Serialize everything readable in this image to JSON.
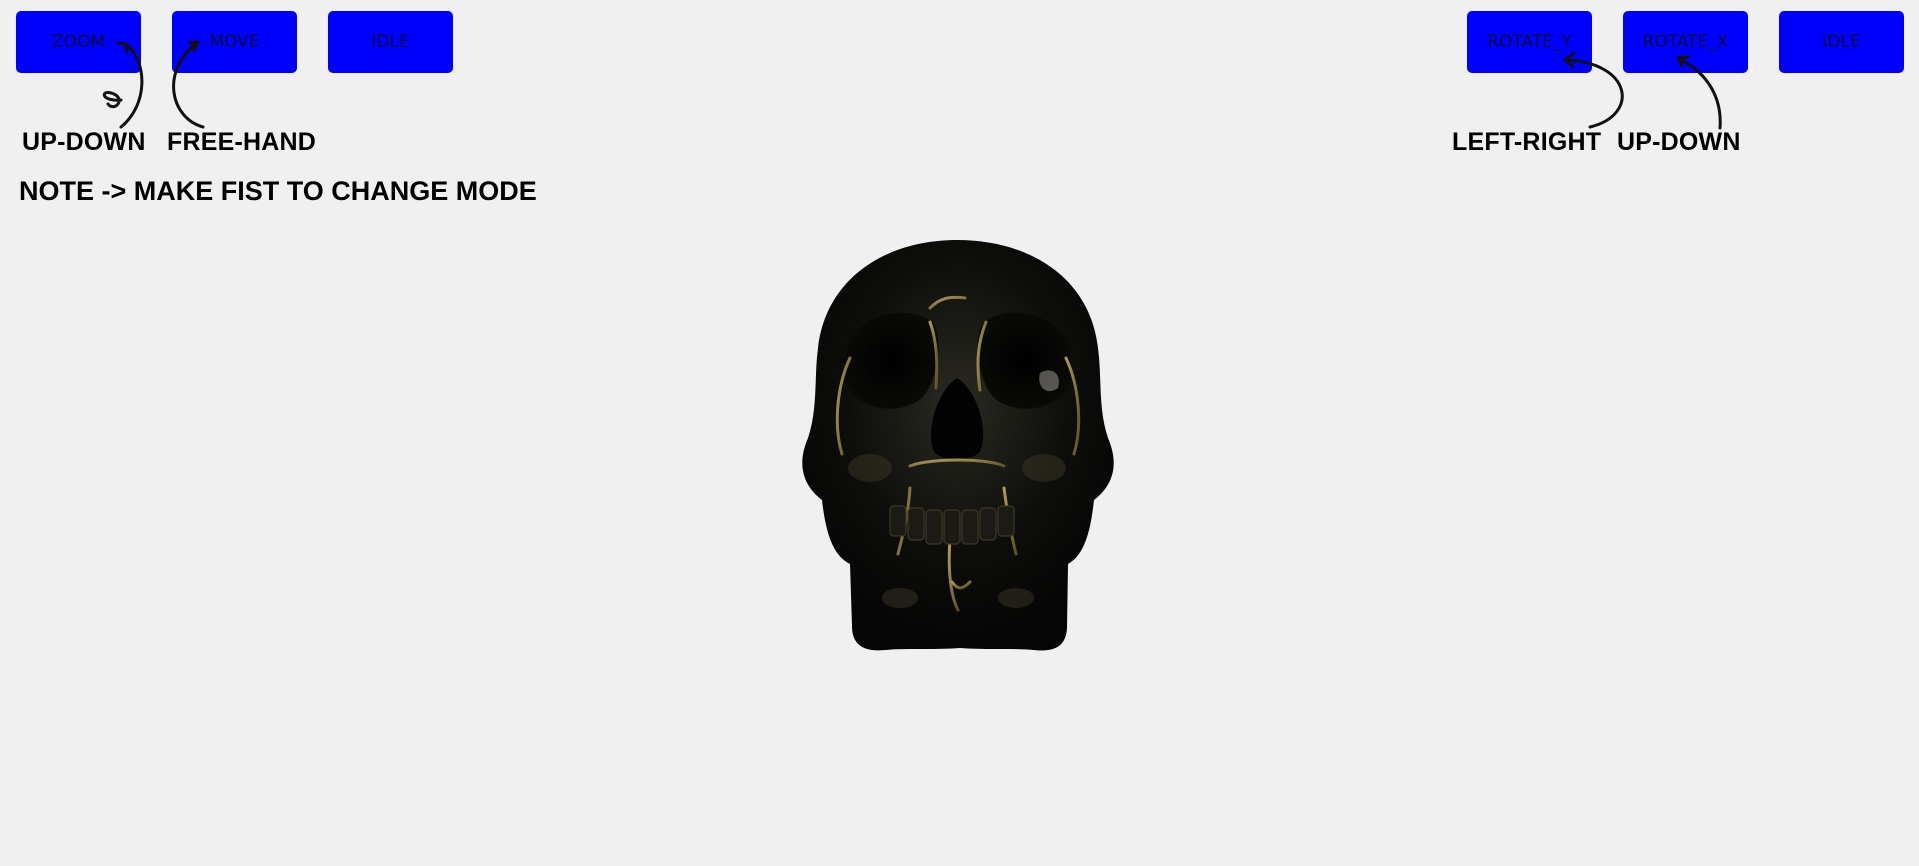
{
  "left_controls": {
    "buttons": [
      {
        "label": "ZOOM"
      },
      {
        "label": "MOVE"
      },
      {
        "label": "IDLE"
      }
    ],
    "hints": [
      {
        "label": "UP-DOWN"
      },
      {
        "label": "FREE-HAND"
      }
    ]
  },
  "right_controls": {
    "buttons": [
      {
        "label": "ROTATE_Y"
      },
      {
        "label": "ROTATE_X"
      },
      {
        "label": "IDLE"
      }
    ],
    "hints": [
      {
        "label": "LEFT-RIGHT"
      },
      {
        "label": "UP-DOWN"
      }
    ]
  },
  "note": "NOTE -> MAKE FIST TO CHANGE MODE",
  "colors": {
    "background": "#f0f0f0",
    "button_fill": "#0000ff",
    "hint_text": "#000000"
  },
  "icons": {
    "model": "skull-3d-model",
    "annotation": "hand-drawn-arrow"
  }
}
